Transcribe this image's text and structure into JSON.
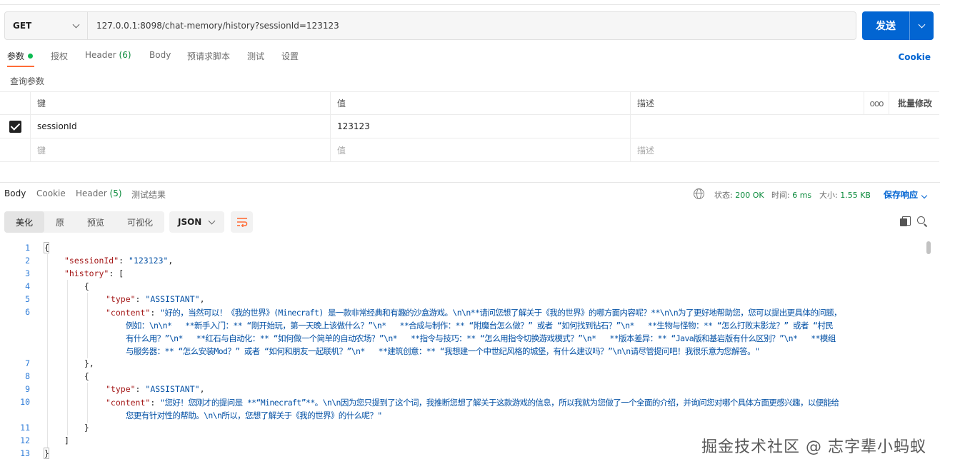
{
  "request": {
    "method": "GET",
    "url": "127.0.0.1:8098/chat-memory/history?sessionId=123123",
    "send_label": "发送"
  },
  "request_tabs": [
    {
      "label": "参数",
      "active": true
    },
    {
      "label": "授权"
    },
    {
      "label": "Header",
      "count": "(6)"
    },
    {
      "label": "Body"
    },
    {
      "label": "预请求脚本"
    },
    {
      "label": "测试"
    },
    {
      "label": "设置"
    }
  ],
  "cookie_link": "Cookie",
  "query_params_title": "查询参数",
  "params_table": {
    "headers": {
      "key": "键",
      "value": "值",
      "description": "描述",
      "more": "⋯",
      "bulk_edit": "批量修改"
    },
    "rows": [
      {
        "checked": true,
        "key": "sessionId",
        "value": "123123",
        "description": ""
      }
    ],
    "placeholders": {
      "key": "键",
      "value": "值",
      "description": "描述"
    }
  },
  "response_tabs": [
    {
      "label": "Body",
      "active": true
    },
    {
      "label": "Cookie"
    },
    {
      "label": "Header",
      "count": "(5)"
    },
    {
      "label": "测试结果"
    }
  ],
  "response_status": {
    "status_label": "状态:",
    "status_value": "200 OK",
    "time_label": "时间:",
    "time_value": "6 ms",
    "size_label": "大小:",
    "size_value": "1.55 KB",
    "save_label": "保存响应"
  },
  "view_modes": [
    "美化",
    "原",
    "预览",
    "可视化"
  ],
  "active_view": "美化",
  "format": "JSON",
  "code": {
    "line_numbers": [
      "1",
      "2",
      "3",
      "4",
      "5",
      "6",
      "7",
      "8",
      "9",
      "10",
      "11",
      "12",
      "13"
    ],
    "open_brace": "{",
    "session_key": "\"sessionId\"",
    "session_value": "\"123123\"",
    "history_key": "\"history\"",
    "history_open": ": [",
    "item_open": "{",
    "type_key": "\"type\"",
    "type_value_1": "\"ASSISTANT\"",
    "content_key": "\"content\"",
    "content_1_line1": "\"好的，当然可以！《我的世界》(Minecraft) 是一款非常经典和有趣的沙盒游戏。\\n\\n**请问您想了解关于《我的世界》的哪方面内容呢？**\\n\\n为了更好地帮助您，您可以提出更具体的问题，",
    "content_1_line2": "例如：\\n\\n*   **新手入门：** “刚开始玩，第一天晚上该做什么？”\\n*   **合成与制作：** “附魔台怎么做？” 或者 “如何找到钻石？”\\n*   **生物与怪物：** “怎么打败末影龙？” 或者 “村民",
    "content_1_line3": "有什么用？”\\n*   **红石与自动化：** “如何做一个简单的自动农场？”\\n*   **指令与技巧：** “怎么用指令切换游戏模式？”\\n*   **版本差异：** “Java版和基岩版有什么区别？”\\n*   **模组",
    "content_1_line4": "与服务器：** “怎么安装Mod？” 或者 “如何和朋友一起联机？”\\n*   **建筑创意：** “我想建一个中世纪风格的城堡，有什么建议吗？”\\n\\n请尽管提问吧！我很乐意为您解答。\"",
    "item_close_comma": "},",
    "type_value_2": "\"ASSISTANT\"",
    "content_2_line1": "\"您好！您刚才的提问是 **“Minecraft”**。\\n\\n因为您只提到了这个词，我推断您想了解关于这款游戏的信息，所以我就为您做了一个全面的介绍，并询问您对哪个具体方面更感兴趣，以便能给",
    "content_2_line2": "您更有针对性的帮助。\\n\\n所以，您想了解关于《我的世界》的什么呢？\"",
    "item_close": "}",
    "array_close": "]",
    "close_brace": "}"
  },
  "watermark": "掘金技术社区 @ 志字辈小蚂蚁",
  "colors": {
    "accent": "#0265d2",
    "tab_underline": "#ff6c37",
    "status_ok": "#0a8a3b",
    "json_key": "#a31515",
    "json_string": "#0451a5",
    "line_number": "#2e7cd8"
  }
}
